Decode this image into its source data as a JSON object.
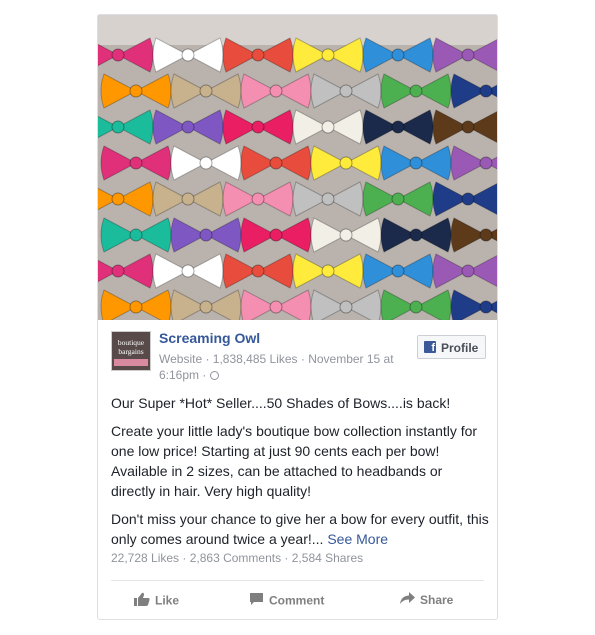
{
  "post": {
    "page_name": "Screaming Owl",
    "logo_text_line1": "boutique",
    "logo_text_line2": "bargains",
    "meta_prefix": "Website · 1,838,485 Likes · November 15 at 6:16pm ·",
    "profile_button": "Profile",
    "paragraph1": "Our Super *Hot* Seller....50 Shades of Bows....is back!",
    "paragraph2": "Create your little lady's boutique bow collection instantly for one low price! Starting at just 90 cents each per bow! Available in 2 sizes, can be attached to headbands or directly in hair. Very high quality!",
    "paragraph3": "Don't miss your chance to give her a bow for every outfit, this only comes around twice a year!...",
    "see_more": "See More",
    "stats": "22,728 Likes · 2,863 Comments · 2,584 Shares"
  },
  "actions": {
    "like": "Like",
    "comment": "Comment",
    "share": "Share"
  },
  "icons": {
    "facebook": "facebook-f-icon",
    "globe": "globe-icon",
    "like": "thumbs-up-icon",
    "comment": "speech-bubble-icon",
    "share": "share-arrow-icon"
  },
  "colors": {
    "link": "#365899",
    "meta": "#90949c",
    "facebook_blue": "#3b5998",
    "action_gray": "#7f7f7f"
  }
}
